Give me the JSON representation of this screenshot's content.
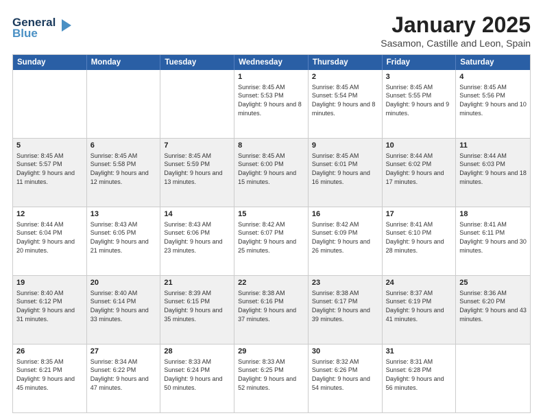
{
  "header": {
    "logo_general": "General",
    "logo_blue": "Blue",
    "title": "January 2025",
    "subtitle": "Sasamon, Castille and Leon, Spain"
  },
  "days_of_week": [
    "Sunday",
    "Monday",
    "Tuesday",
    "Wednesday",
    "Thursday",
    "Friday",
    "Saturday"
  ],
  "rows": [
    [
      {
        "day": "",
        "info": "",
        "shaded": false
      },
      {
        "day": "",
        "info": "",
        "shaded": false
      },
      {
        "day": "",
        "info": "",
        "shaded": false
      },
      {
        "day": "1",
        "info": "Sunrise: 8:45 AM\nSunset: 5:53 PM\nDaylight: 9 hours\nand 8 minutes.",
        "shaded": false
      },
      {
        "day": "2",
        "info": "Sunrise: 8:45 AM\nSunset: 5:54 PM\nDaylight: 9 hours\nand 8 minutes.",
        "shaded": false
      },
      {
        "day": "3",
        "info": "Sunrise: 8:45 AM\nSunset: 5:55 PM\nDaylight: 9 hours\nand 9 minutes.",
        "shaded": false
      },
      {
        "day": "4",
        "info": "Sunrise: 8:45 AM\nSunset: 5:56 PM\nDaylight: 9 hours\nand 10 minutes.",
        "shaded": false
      }
    ],
    [
      {
        "day": "5",
        "info": "Sunrise: 8:45 AM\nSunset: 5:57 PM\nDaylight: 9 hours\nand 11 minutes.",
        "shaded": true
      },
      {
        "day": "6",
        "info": "Sunrise: 8:45 AM\nSunset: 5:58 PM\nDaylight: 9 hours\nand 12 minutes.",
        "shaded": true
      },
      {
        "day": "7",
        "info": "Sunrise: 8:45 AM\nSunset: 5:59 PM\nDaylight: 9 hours\nand 13 minutes.",
        "shaded": true
      },
      {
        "day": "8",
        "info": "Sunrise: 8:45 AM\nSunset: 6:00 PM\nDaylight: 9 hours\nand 15 minutes.",
        "shaded": true
      },
      {
        "day": "9",
        "info": "Sunrise: 8:45 AM\nSunset: 6:01 PM\nDaylight: 9 hours\nand 16 minutes.",
        "shaded": true
      },
      {
        "day": "10",
        "info": "Sunrise: 8:44 AM\nSunset: 6:02 PM\nDaylight: 9 hours\nand 17 minutes.",
        "shaded": true
      },
      {
        "day": "11",
        "info": "Sunrise: 8:44 AM\nSunset: 6:03 PM\nDaylight: 9 hours\nand 18 minutes.",
        "shaded": true
      }
    ],
    [
      {
        "day": "12",
        "info": "Sunrise: 8:44 AM\nSunset: 6:04 PM\nDaylight: 9 hours\nand 20 minutes.",
        "shaded": false
      },
      {
        "day": "13",
        "info": "Sunrise: 8:43 AM\nSunset: 6:05 PM\nDaylight: 9 hours\nand 21 minutes.",
        "shaded": false
      },
      {
        "day": "14",
        "info": "Sunrise: 8:43 AM\nSunset: 6:06 PM\nDaylight: 9 hours\nand 23 minutes.",
        "shaded": false
      },
      {
        "day": "15",
        "info": "Sunrise: 8:42 AM\nSunset: 6:07 PM\nDaylight: 9 hours\nand 25 minutes.",
        "shaded": false
      },
      {
        "day": "16",
        "info": "Sunrise: 8:42 AM\nSunset: 6:09 PM\nDaylight: 9 hours\nand 26 minutes.",
        "shaded": false
      },
      {
        "day": "17",
        "info": "Sunrise: 8:41 AM\nSunset: 6:10 PM\nDaylight: 9 hours\nand 28 minutes.",
        "shaded": false
      },
      {
        "day": "18",
        "info": "Sunrise: 8:41 AM\nSunset: 6:11 PM\nDaylight: 9 hours\nand 30 minutes.",
        "shaded": false
      }
    ],
    [
      {
        "day": "19",
        "info": "Sunrise: 8:40 AM\nSunset: 6:12 PM\nDaylight: 9 hours\nand 31 minutes.",
        "shaded": true
      },
      {
        "day": "20",
        "info": "Sunrise: 8:40 AM\nSunset: 6:14 PM\nDaylight: 9 hours\nand 33 minutes.",
        "shaded": true
      },
      {
        "day": "21",
        "info": "Sunrise: 8:39 AM\nSunset: 6:15 PM\nDaylight: 9 hours\nand 35 minutes.",
        "shaded": true
      },
      {
        "day": "22",
        "info": "Sunrise: 8:38 AM\nSunset: 6:16 PM\nDaylight: 9 hours\nand 37 minutes.",
        "shaded": true
      },
      {
        "day": "23",
        "info": "Sunrise: 8:38 AM\nSunset: 6:17 PM\nDaylight: 9 hours\nand 39 minutes.",
        "shaded": true
      },
      {
        "day": "24",
        "info": "Sunrise: 8:37 AM\nSunset: 6:19 PM\nDaylight: 9 hours\nand 41 minutes.",
        "shaded": true
      },
      {
        "day": "25",
        "info": "Sunrise: 8:36 AM\nSunset: 6:20 PM\nDaylight: 9 hours\nand 43 minutes.",
        "shaded": true
      }
    ],
    [
      {
        "day": "26",
        "info": "Sunrise: 8:35 AM\nSunset: 6:21 PM\nDaylight: 9 hours\nand 45 minutes.",
        "shaded": false
      },
      {
        "day": "27",
        "info": "Sunrise: 8:34 AM\nSunset: 6:22 PM\nDaylight: 9 hours\nand 47 minutes.",
        "shaded": false
      },
      {
        "day": "28",
        "info": "Sunrise: 8:33 AM\nSunset: 6:24 PM\nDaylight: 9 hours\nand 50 minutes.",
        "shaded": false
      },
      {
        "day": "29",
        "info": "Sunrise: 8:33 AM\nSunset: 6:25 PM\nDaylight: 9 hours\nand 52 minutes.",
        "shaded": false
      },
      {
        "day": "30",
        "info": "Sunrise: 8:32 AM\nSunset: 6:26 PM\nDaylight: 9 hours\nand 54 minutes.",
        "shaded": false
      },
      {
        "day": "31",
        "info": "Sunrise: 8:31 AM\nSunset: 6:28 PM\nDaylight: 9 hours\nand 56 minutes.",
        "shaded": false
      },
      {
        "day": "",
        "info": "",
        "shaded": false
      }
    ]
  ]
}
